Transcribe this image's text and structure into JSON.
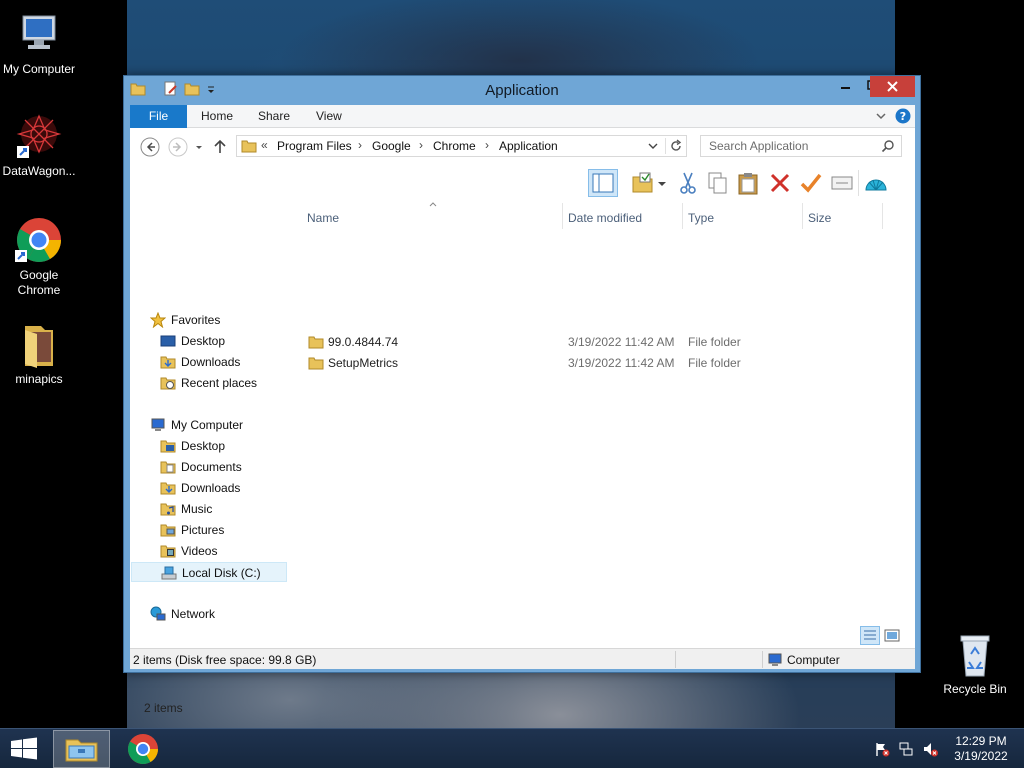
{
  "desktop": {
    "icons": [
      {
        "label": "My Computer"
      },
      {
        "label": "DataWagon..."
      },
      {
        "label": "Google Chrome"
      },
      {
        "label": "minapics"
      },
      {
        "label": "Recycle Bin"
      }
    ]
  },
  "window": {
    "title": "Application",
    "ribbon_tabs": [
      "File",
      "Home",
      "Share",
      "View"
    ],
    "breadcrumb": {
      "overflow": "«",
      "parts": [
        "Program Files",
        "Google",
        "Chrome",
        "Application"
      ]
    },
    "search_placeholder": "Search Application",
    "navpane": {
      "favorites": {
        "label": "Favorites",
        "items": [
          "Desktop",
          "Downloads",
          "Recent places"
        ]
      },
      "computer": {
        "label": "My Computer",
        "items": [
          "Desktop",
          "Documents",
          "Downloads",
          "Music",
          "Pictures",
          "Videos",
          "Local Disk (C:)"
        ]
      },
      "network": {
        "label": "Network"
      }
    },
    "columns": [
      "Name",
      "Date modified",
      "Type",
      "Size"
    ],
    "files": [
      {
        "name": "99.0.4844.74",
        "date": "3/19/2022 11:42 AM",
        "type": "File folder",
        "size": ""
      },
      {
        "name": "SetupMetrics",
        "date": "3/19/2022 11:42 AM",
        "type": "File folder",
        "size": ""
      }
    ],
    "item_count": "2 items",
    "status_left": "2 items (Disk free space: 99.8 GB)",
    "status_right": "Computer"
  },
  "taskbar": {
    "time": "12:29 PM",
    "date": "3/19/2022"
  },
  "colors": {
    "file_tab": "#1979ca",
    "close_button": "#c7403a",
    "window_frame": "#6fa6d6",
    "taskbar": "#1a2c44"
  }
}
